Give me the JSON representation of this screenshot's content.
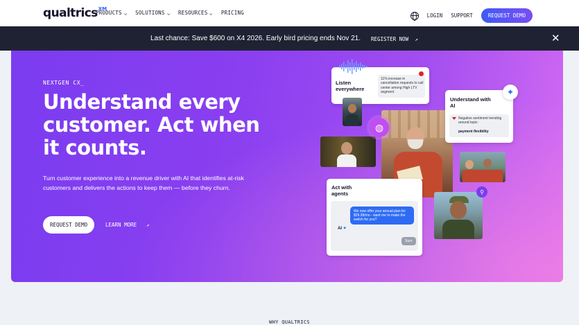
{
  "nav": {
    "logo": "qualtrics",
    "logo_mark": "XM",
    "menu": [
      {
        "label": "PRODUCTS",
        "has_dropdown": true
      },
      {
        "label": "SOLUTIONS",
        "has_dropdown": true
      },
      {
        "label": "RESOURCES",
        "has_dropdown": true
      },
      {
        "label": "PRICING",
        "has_dropdown": false
      }
    ],
    "login": "LOGIN",
    "support": "SUPPORT",
    "request_demo": "REQUEST DEMO",
    "globe_icon": "globe-icon"
  },
  "banner": {
    "text": "Last chance: Save $600 on X4 2026. Early bird pricing ends Nov 21.",
    "link": "REGISTER NOW",
    "link_icon": "↗",
    "close": "✕"
  },
  "hero": {
    "eyebrow": "NEXTGEN CX_",
    "headline": "Understand every customer. Act when it counts.",
    "subtext": "Turn customer experience into a revenue driver with AI that identifies at-risk customers and delivers the actions to keep them — before they churn.",
    "cta": "REQUEST DEMO",
    "learn_more": "LEARN MORE",
    "learn_icon": "↗"
  },
  "collage": {
    "listen": {
      "title": "Listen everywhere",
      "insight": "11% increase in cancellation requests to call center among High LTV segment"
    },
    "understand": {
      "title": "Understand with AI",
      "insight_title": "Negative sentiment trending around topic:",
      "insight_topic": "payment flexibility"
    },
    "act": {
      "title": "Act with agents",
      "message": "We now offer your annual plan for $29.99/mo - want me to make the switch for you?",
      "ai_label": "AI",
      "reply": "Sure"
    }
  },
  "section": {
    "why": "WHY QUALTRICS"
  },
  "colors": {
    "brand_gradient_start": "#7b3cf0",
    "brand_gradient_end": "#d56cf3",
    "banner_bg": "#1f2233",
    "demo_button": "#3d5bf5"
  }
}
